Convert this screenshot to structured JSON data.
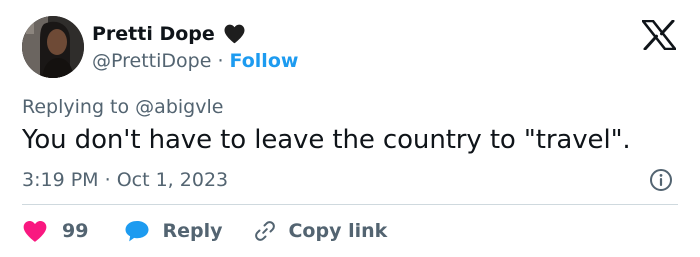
{
  "author": {
    "display_name": "Pretti Dope",
    "handle": "@PrettiDope",
    "separator": "·",
    "follow_label": "Follow"
  },
  "reply_context": {
    "prefix": "Replying to",
    "mention": "@abigvle"
  },
  "tweet": {
    "text": "You don't have to leave the country to \"travel\".",
    "time": "3:19 PM",
    "separator": "·",
    "date": "Oct 1, 2023"
  },
  "actions": {
    "like_count": "99",
    "reply_label": "Reply",
    "copy_link_label": "Copy link"
  },
  "icons": {
    "name_badge": "black-heart-icon",
    "brand": "x-logo-icon",
    "info": "info-icon",
    "like": "heart-icon",
    "reply": "speech-bubble-icon",
    "copy_link": "link-icon"
  },
  "colors": {
    "text_primary": "#0f1419",
    "text_secondary": "#536471",
    "accent_blue": "#1d9bf0",
    "like_pink": "#f91880",
    "divider": "#cfd9de"
  }
}
